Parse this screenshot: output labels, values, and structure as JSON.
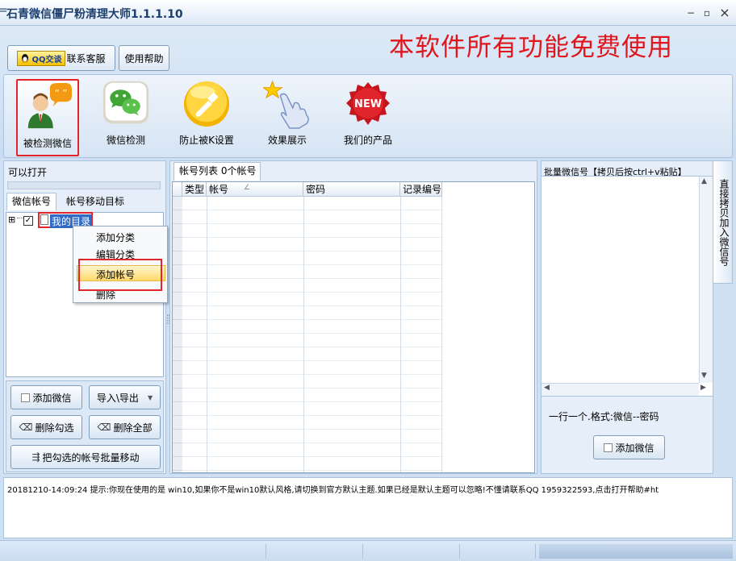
{
  "window": {
    "title": "石青微信僵尸粉清理大师1.1.1.10",
    "menu_glyph": "=",
    "minimize": "−",
    "restore": "▫",
    "close": "×"
  },
  "toolbar": {
    "qq_badge": "QQ交谈",
    "contact_label": "联系客服",
    "help_label": "使用帮助",
    "promo": "本软件所有功能免费使用"
  },
  "big_buttons": [
    {
      "label": "被检测微信",
      "icon": "user-chat-icon"
    },
    {
      "label": "微信检测",
      "icon": "wechat-icon"
    },
    {
      "label": "防止被K设置",
      "icon": "wrench-icon"
    },
    {
      "label": "效果展示",
      "icon": "hand-star-icon"
    },
    {
      "label": "我们的产品",
      "icon": "new-badge-icon"
    }
  ],
  "left": {
    "status": "可以打开",
    "tabs": [
      "微信帐号",
      "帐号移动目标"
    ],
    "tree_expand": "⊞",
    "tree_root": "我的目录",
    "context_menu": [
      "添加分类",
      "编辑分类",
      "添加帐号",
      "删除"
    ],
    "buttons": {
      "add_wechat": "添加微信",
      "import_export": "导入\\导出",
      "delete_checked": "删除勾选",
      "delete_all": "删除全部",
      "batch_move": "把勾选的帐号批量移动"
    }
  },
  "middle": {
    "tab_label": "帐号列表 0个帐号",
    "columns": [
      "类型",
      "帐号",
      "密码",
      "记录编号"
    ]
  },
  "right": {
    "title": "批量微信号【拷贝后按ctrl+v粘贴】",
    "format_hint": "一行一个.格式:微信--密码",
    "add_button": "添加微信",
    "side_tab": "直接拷贝加入微信号"
  },
  "status_log": "20181210-14:09:24  提示:你现在使用的是 win10,如果你不是win10默认风格,请切换到官方默认主题.如果已经是默认主题可以忽略!不懂请联系QQ 1959322593,点击打开帮助#ht",
  "colors": {
    "accent": "#1d3f6e",
    "promo": "#e0161d",
    "highlight_border": "#e1252a",
    "selection": "#316ac5"
  }
}
